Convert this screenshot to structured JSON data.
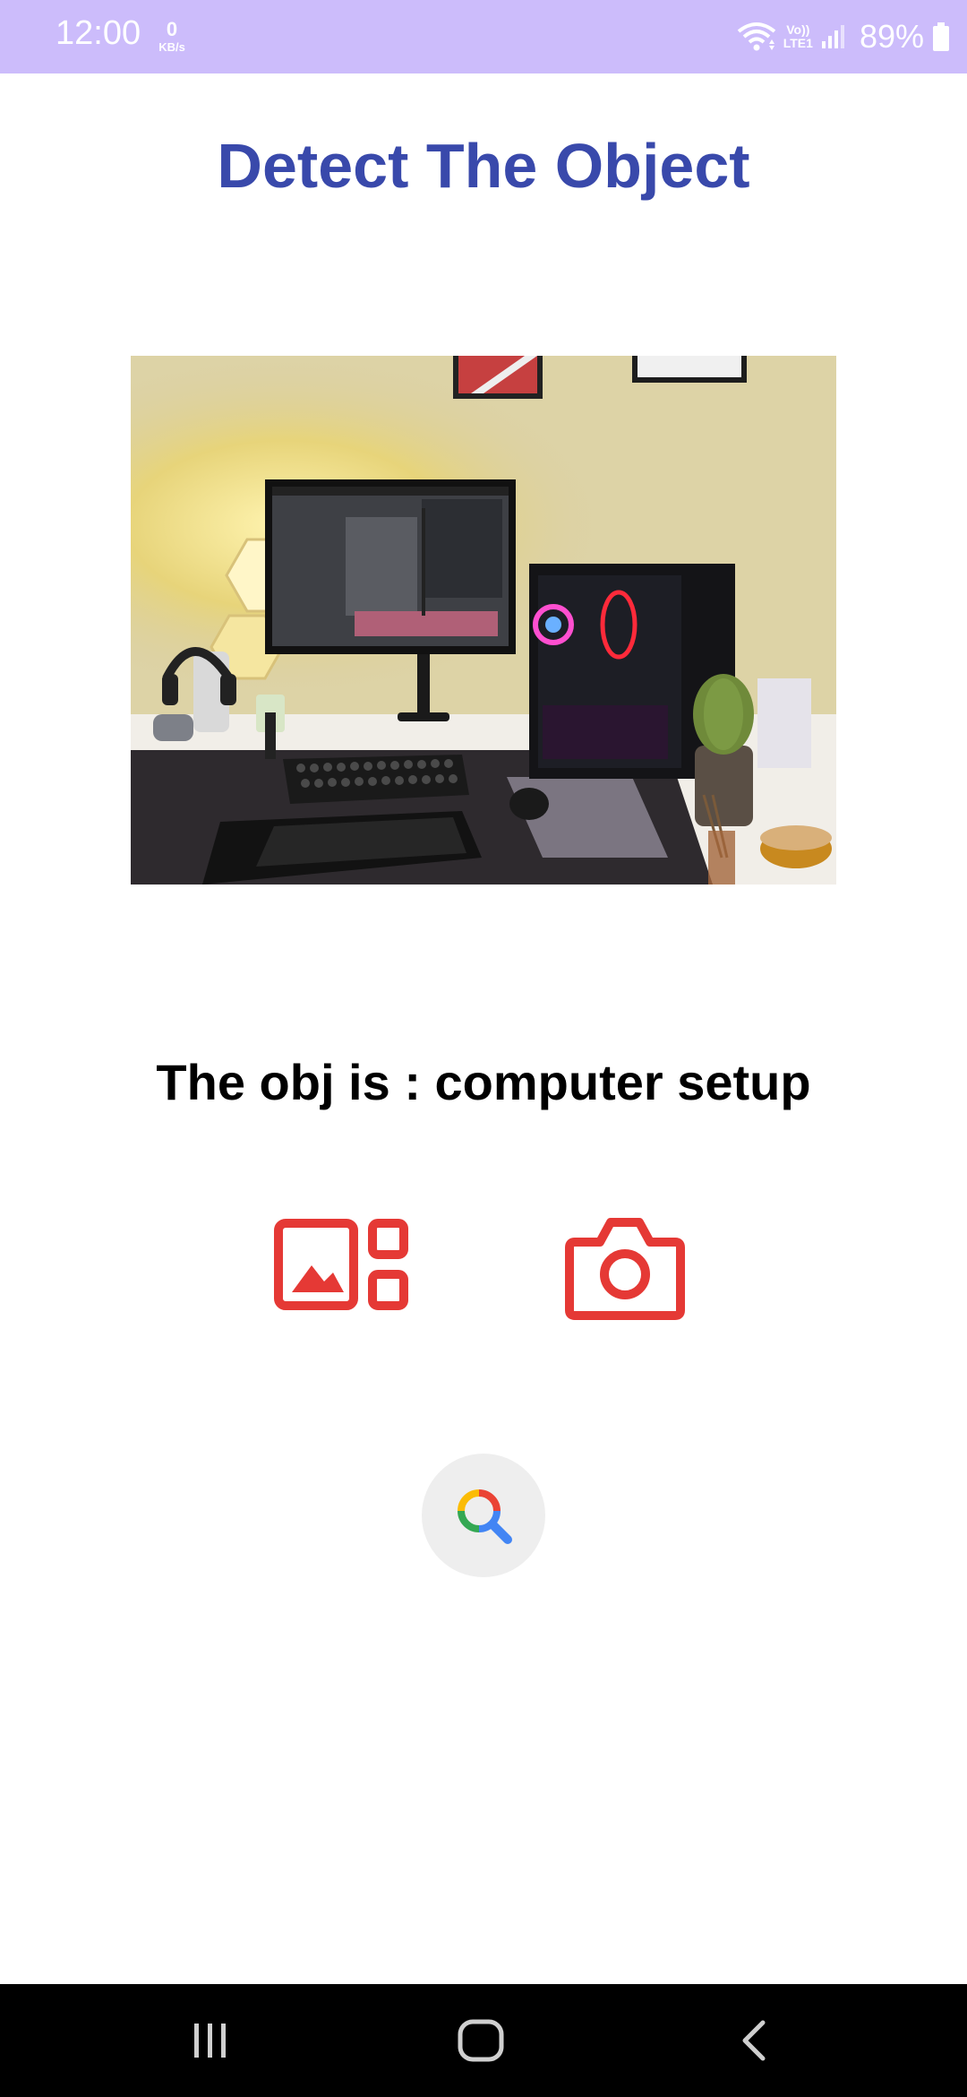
{
  "status_bar": {
    "time": "12:00",
    "data_speed_value": "0",
    "data_speed_unit": "KB/s",
    "network_label_top": "Vo))",
    "network_label_bottom": "LTE1",
    "battery_percent": "89%",
    "icons": [
      "wifi-icon",
      "signal-icon",
      "battery-icon"
    ]
  },
  "title": "Detect The Object",
  "photo": {
    "subject": "computer setup"
  },
  "result": {
    "text": "The obj is : computer setup"
  },
  "actions": {
    "gallery_icon": "image-gallery-icon",
    "camera_icon": "camera-icon",
    "search_icon": "search-icon"
  },
  "nav_bar": {
    "icons": [
      "recent-apps-icon",
      "home-icon",
      "back-icon"
    ]
  },
  "colors": {
    "status_bar": "#ccbcfb",
    "title": "#3949ab",
    "action_icon": "#e53935",
    "search_bg": "#eeeeee",
    "nav_bar": "#000000"
  }
}
